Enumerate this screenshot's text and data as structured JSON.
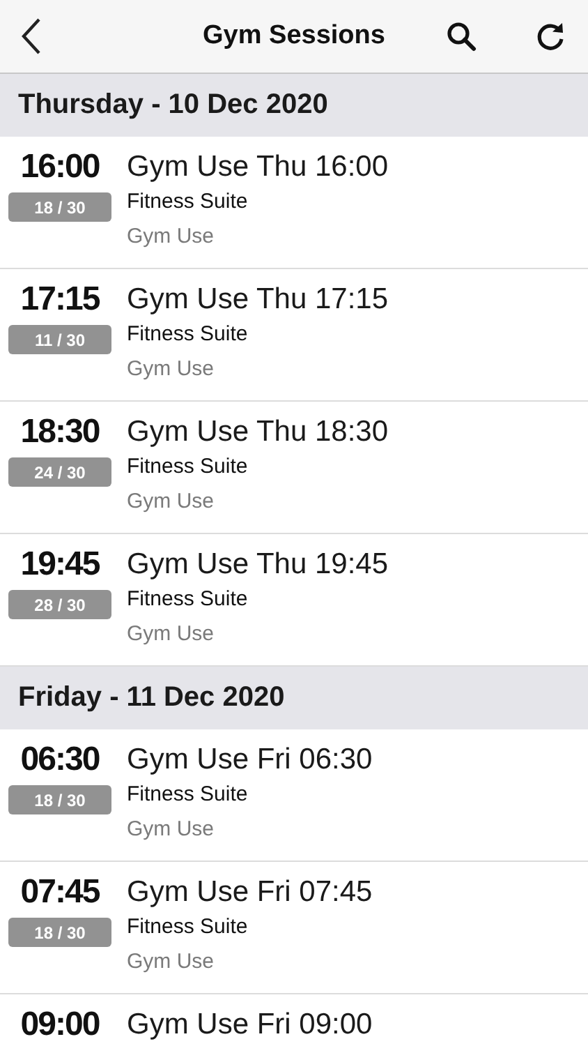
{
  "header": {
    "title": "Gym Sessions"
  },
  "sections": [
    {
      "title": "Thursday - 10 Dec 2020",
      "sessions": [
        {
          "time": "16:00",
          "capacity": "18 / 30",
          "title": "Gym Use Thu 16:00",
          "location": "Fitness Suite",
          "category": "Gym Use"
        },
        {
          "time": "17:15",
          "capacity": "11 / 30",
          "title": "Gym Use Thu 17:15",
          "location": "Fitness Suite",
          "category": "Gym Use"
        },
        {
          "time": "18:30",
          "capacity": "24 / 30",
          "title": "Gym Use Thu 18:30",
          "location": "Fitness Suite",
          "category": "Gym Use"
        },
        {
          "time": "19:45",
          "capacity": "28 / 30",
          "title": "Gym Use Thu 19:45",
          "location": "Fitness Suite",
          "category": "Gym Use"
        }
      ]
    },
    {
      "title": "Friday - 11 Dec 2020",
      "sessions": [
        {
          "time": "06:30",
          "capacity": "18 / 30",
          "title": "Gym Use Fri 06:30",
          "location": "Fitness Suite",
          "category": "Gym Use"
        },
        {
          "time": "07:45",
          "capacity": "18 / 30",
          "title": "Gym Use Fri 07:45",
          "location": "Fitness Suite",
          "category": "Gym Use"
        },
        {
          "time": "09:00",
          "title": "Gym Use Fri 09:00"
        }
      ]
    }
  ]
}
